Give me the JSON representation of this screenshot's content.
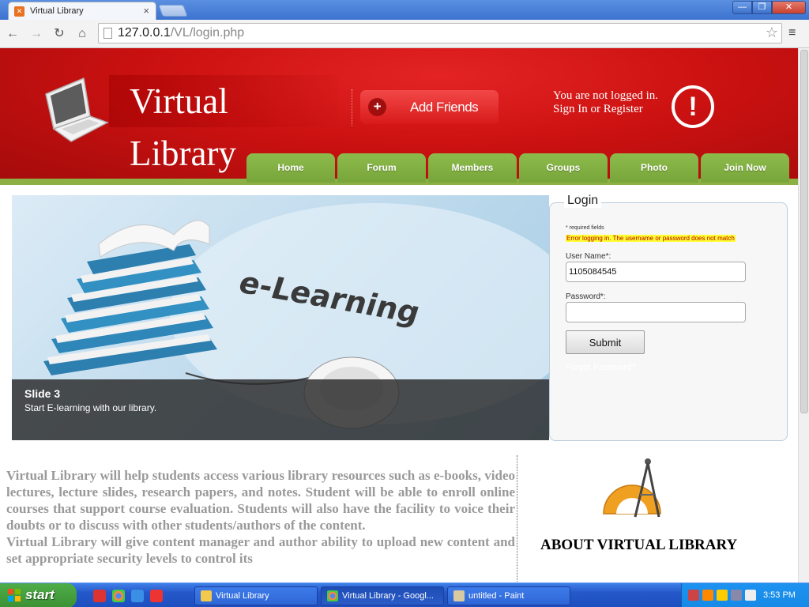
{
  "browser": {
    "tab_title": "Virtual Library",
    "tab_close": "×",
    "url_host": "127.0.0.1",
    "url_path": "/VL/login.php",
    "window_buttons": {
      "minimize": "—",
      "maximize": "❐",
      "close": "✕"
    }
  },
  "header": {
    "site_title": "Virtual Library",
    "add_friends_label": "Add Friends",
    "login_status_line1": "You are not logged in.",
    "login_status_line2": "Sign In or Register",
    "colors": {
      "header_red": "#cc1111",
      "nav_green": "#8cb044"
    }
  },
  "nav": {
    "items": [
      "Home",
      "Forum",
      "Members",
      "Groups",
      "Photo",
      "Join Now"
    ]
  },
  "slider": {
    "title": "Slide 3",
    "subtitle": "Start E-learning with our library.",
    "image_text": "e-Learning"
  },
  "login": {
    "legend": "Login",
    "required_note": "* required fields",
    "error_message": "Error logging in. The username or password does not match",
    "username_label": "User Name*:",
    "username_value": "1105084545",
    "password_label": "Password*:",
    "password_value": "",
    "submit_label": "Submit",
    "forgot_label": "Forgot Password?"
  },
  "content": {
    "paragraph1": "Virtual Library will help students access various library resources such as e-books, video lectures, lecture slides, research papers, and notes. Student will be able to enroll online courses that support course evaluation. Students will also have the facility to voice their doubts or to discuss with other students/authors of the content.",
    "paragraph2": "Virtual Library will give content manager and author ability to upload new content and set appropriate security levels to control its",
    "about_title": "ABOUT VIRTUAL LIBRARY"
  },
  "taskbar": {
    "start_label": "start",
    "tasks": [
      {
        "label": "Virtual Library",
        "icon": "folder-icon"
      },
      {
        "label": "Virtual Library - Googl...",
        "icon": "chrome-icon"
      },
      {
        "label": "untitled - Paint",
        "icon": "paint-icon"
      }
    ],
    "clock": "3:53 PM"
  }
}
